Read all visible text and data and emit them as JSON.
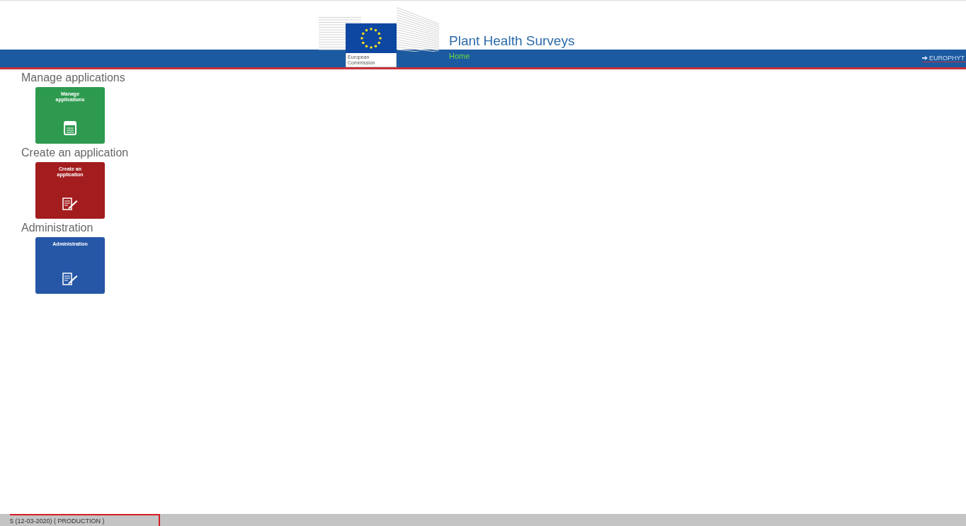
{
  "header": {
    "logo_text": [
      "European",
      "Commission"
    ],
    "title": "Plant Health Surveys"
  },
  "nav": {
    "items": [
      {
        "label": "Home",
        "selected": true
      }
    ],
    "external_link": "EUROPHYT"
  },
  "sections": [
    {
      "heading": "Manage applications",
      "tile": {
        "label": "Manage applications",
        "color": "#2e9a4f",
        "kind": "calendar"
      }
    },
    {
      "heading": "Create an application",
      "tile": {
        "label": "Create an application",
        "color": "#a31d1f",
        "kind": "form"
      }
    },
    {
      "heading": "Administration",
      "tile": {
        "label": "Administration",
        "color": "#2657a6",
        "kind": "form"
      }
    }
  ],
  "status_bar": {
    "version": "5 (12-03-2020) ( PRODUCTION )"
  }
}
